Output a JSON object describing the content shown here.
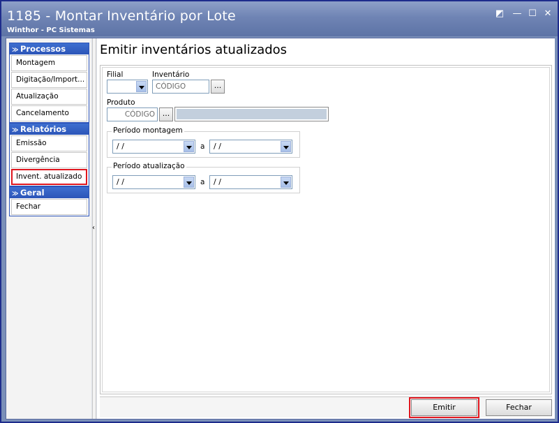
{
  "window": {
    "title": "1185 - Montar Inventário por Lote",
    "subtitle": "Winthor - PC Sistemas",
    "buttons": {
      "restore": "◩",
      "minimize": "—",
      "maximize": "☐",
      "close": "✕"
    }
  },
  "sidebar": {
    "groups": [
      {
        "title": "Processos",
        "items": [
          "Montagem",
          "Digitação/Import...",
          "Atualização",
          "Cancelamento"
        ]
      },
      {
        "title": "Relatórios",
        "items": [
          "Emissão",
          "Divergência",
          "Invent. atualizado"
        ]
      },
      {
        "title": "Geral",
        "items": [
          "Fechar"
        ]
      }
    ],
    "selected_item": "Invent. atualizado"
  },
  "main": {
    "title": "Emitir inventários atualizados",
    "filial": {
      "label": "Filial",
      "value": ""
    },
    "inventario": {
      "label": "Inventário",
      "placeholder": "CÓDIGO",
      "button": "..."
    },
    "produto": {
      "label": "Produto",
      "placeholder": "CÓDIGO",
      "button": "...",
      "description": ""
    },
    "periodo_montagem": {
      "legend": "Período montagem",
      "from": "/ /",
      "sep": "a",
      "to": "/ /"
    },
    "periodo_atualizacao": {
      "legend": "Período atualização",
      "from": "/ /",
      "sep": "a",
      "to": "/ /"
    }
  },
  "actions": {
    "emitir": "Emitir",
    "fechar": "Fechar"
  },
  "colors": {
    "highlight": "#e0161e",
    "sidebar_header": "#2c55b8",
    "titlebar": "#6f84b4"
  }
}
